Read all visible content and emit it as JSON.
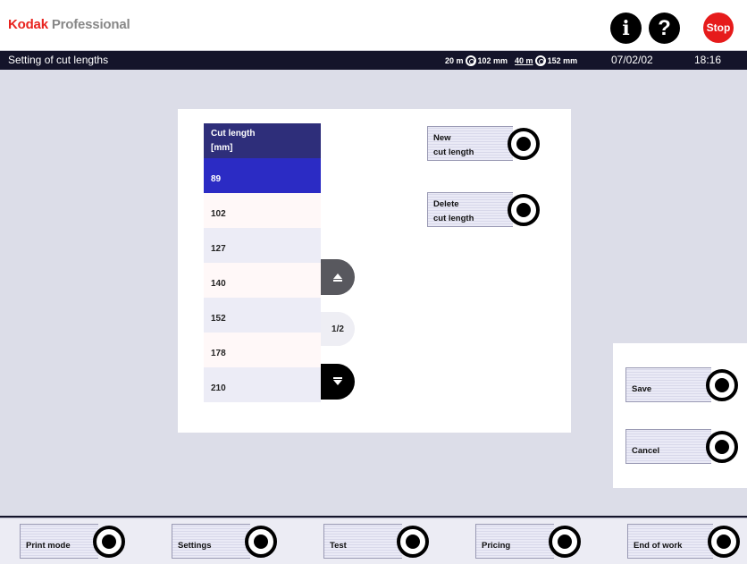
{
  "header": {
    "brand_kodak": "Kodak",
    "brand_pro": "Professional",
    "info_label": "i",
    "help_label": "?",
    "stop_label": "Stop"
  },
  "titlebar": {
    "title": "Setting of cut lengths",
    "roll1_len": "20 m",
    "roll1_width": "102 mm",
    "roll2_len": "40 m",
    "roll2_width": "152 mm",
    "date": "07/02/02",
    "time": "18:16"
  },
  "cut_list": {
    "header_line1": "Cut length",
    "header_line2": "[mm]",
    "items": [
      "89",
      "102",
      "127",
      "140",
      "152",
      "178",
      "210"
    ],
    "selected_index": 0,
    "page": "1/2"
  },
  "actions": {
    "new_line1": "New",
    "new_line2": "cut length",
    "delete_line1": "Delete",
    "delete_line2": "cut length",
    "save": "Save",
    "cancel": "Cancel"
  },
  "bottom_menu": {
    "print_mode": "Print mode",
    "settings": "Settings",
    "test": "Test",
    "pricing": "Pricing",
    "end_of_work": "End of work"
  },
  "colors": {
    "brand_red": "#e8231e",
    "titlebar_bg": "#14142a",
    "list_header_bg": "#2e2e7a",
    "selected_row_bg": "#2b2bc4",
    "stop_red": "#e61b1b"
  }
}
